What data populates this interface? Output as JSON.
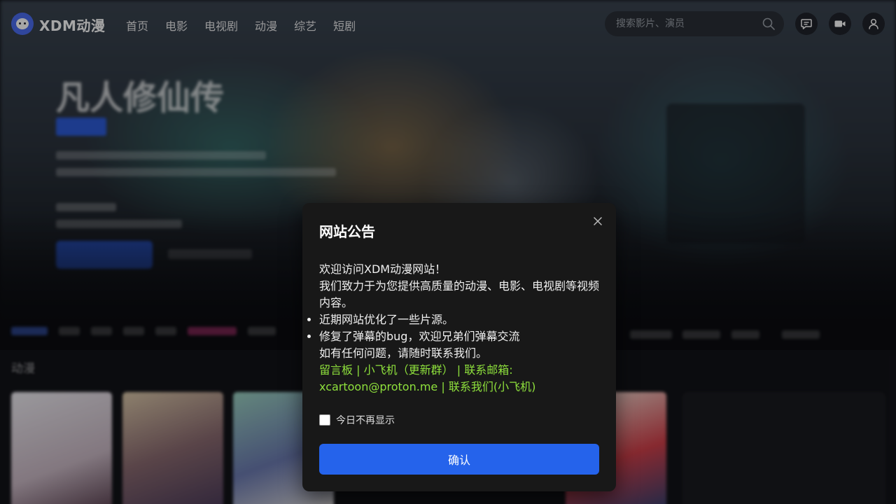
{
  "header": {
    "logo_text": "XDM动漫",
    "nav": [
      "首页",
      "电影",
      "电视剧",
      "动漫",
      "综艺",
      "短剧"
    ],
    "search_placeholder": "搜索影片、演员"
  },
  "background": {
    "hero_title": "凡人修仙传",
    "section_title": "动漫"
  },
  "modal": {
    "title": "网站公告",
    "welcome": "欢迎访问XDM动漫网站！",
    "intro": "我们致力于为您提供高质量的动漫、电影、电视剧等视频内容。",
    "bullets": [
      "近期网站优化了一些片源。",
      "修复了弹幕的bug，欢迎兄弟们弹幕交流"
    ],
    "contact_note": "如有任何问题，请随时联系我们。",
    "link_message_board": "留言板",
    "link_plane_group": "小飞机（更新群）",
    "email_label": "联系邮箱:",
    "email": "xcartoon@proton.me",
    "link_contact": "联系我们(小飞机)",
    "separator": "|",
    "dont_show_label": "今日不再显示",
    "dont_show_checked": false,
    "confirm_label": "确认"
  },
  "colors": {
    "accent": "#2563eb",
    "link": "#8ee03c",
    "modal_bg": "#181818"
  }
}
